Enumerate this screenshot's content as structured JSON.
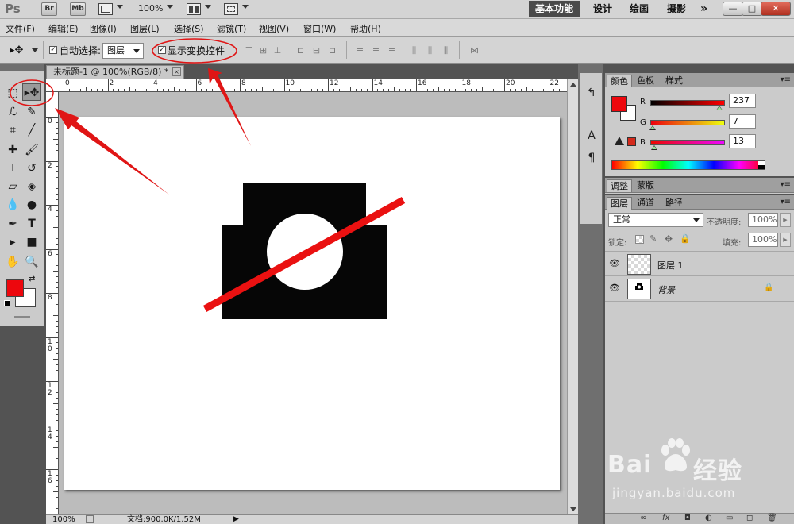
{
  "app": {
    "logo": "Ps",
    "btn_br": "Br",
    "btn_mb": "Mb",
    "zoom": "100%",
    "workspaces": [
      "基本功能",
      "设计",
      "绘画",
      "摄影"
    ],
    "more": "»"
  },
  "menu": [
    "文件(F)",
    "编辑(E)",
    "图像(I)",
    "图层(L)",
    "选择(S)",
    "滤镜(T)",
    "视图(V)",
    "窗口(W)",
    "帮助(H)"
  ],
  "options": {
    "auto_select_label": "自动选择:",
    "auto_select_value": "图层",
    "show_transform_label": "显示变换控件",
    "checkmark": "✓"
  },
  "document": {
    "tab_title": "未标题-1 @ 100%(RGB/8) *",
    "close": "×",
    "ruler_h": [
      "0",
      "2",
      "4",
      "6",
      "8",
      "10",
      "12",
      "14",
      "16",
      "18",
      "20",
      "22"
    ],
    "ruler_v": [
      "0",
      "2",
      "4",
      "6",
      "8",
      "10",
      "12",
      "14",
      "16"
    ],
    "canvas_bg": "#ffffff",
    "shape_color": "#060606",
    "line_color": "#ea1111"
  },
  "status": {
    "zoom": "100%",
    "doc_info": "文档:900.0K/1.52M"
  },
  "color_panel": {
    "tabs": [
      "颜色",
      "色板",
      "样式"
    ],
    "r_label": "R",
    "g_label": "G",
    "b_label": "B",
    "r_value": "237",
    "g_value": "7",
    "b_value": "13",
    "r_level": 0.929,
    "g_level": 0.027,
    "b_level": 0.051,
    "foreground": "#ed070d",
    "warning": "!"
  },
  "adjust_panel": {
    "tabs": [
      "调整",
      "蒙版"
    ]
  },
  "layers_panel": {
    "tabs": [
      "图层",
      "通道",
      "路径"
    ],
    "blend_mode": "正常",
    "opacity_label": "不透明度:",
    "opacity_value": "100%",
    "lock_label": "锁定:",
    "fill_label": "填充:",
    "fill_value": "100%",
    "layers": [
      {
        "name": "图层 1"
      },
      {
        "name": "背景"
      }
    ],
    "bottom_icons": [
      "∞",
      "fx",
      "◘",
      "◐",
      "▭",
      "◻",
      "🗑"
    ]
  },
  "watermark": {
    "logo_a": "Bai",
    "logo_b": "经验",
    "url": "jingyan.baidu.com"
  },
  "colors": {
    "accent_red": "#ed070d",
    "annotation_red": "#e01515"
  }
}
